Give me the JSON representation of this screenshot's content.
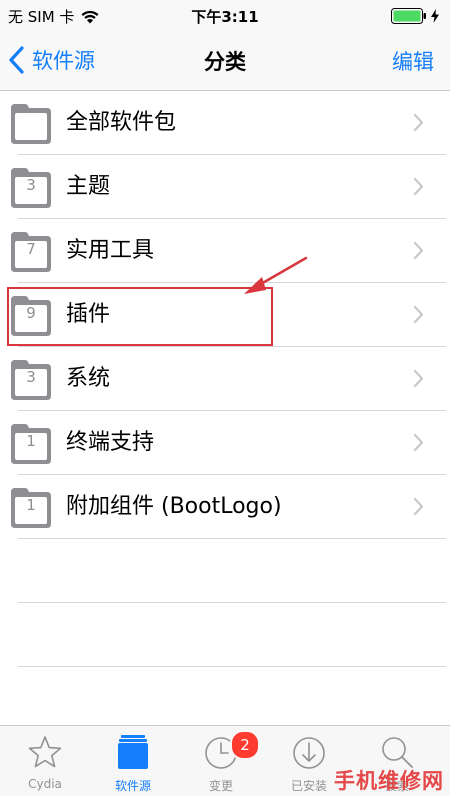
{
  "status_bar": {
    "carrier": "无 SIM 卡",
    "time": "下午3:11"
  },
  "nav": {
    "back_label": "软件源",
    "title": "分类",
    "edit_label": "编辑"
  },
  "categories": [
    {
      "label": "全部软件包",
      "count": ""
    },
    {
      "label": "主题",
      "count": "3"
    },
    {
      "label": "实用工具",
      "count": "7"
    },
    {
      "label": "插件",
      "count": "9"
    },
    {
      "label": "系统",
      "count": "3"
    },
    {
      "label": "终端支持",
      "count": "1"
    },
    {
      "label": "附加组件 (BootLogo)",
      "count": "1"
    }
  ],
  "annotation": {
    "highlighted_row": "插件",
    "color": "#d9363e"
  },
  "tab_bar": {
    "tabs": [
      {
        "label": "Cydia",
        "icon": "star-icon",
        "active": false
      },
      {
        "label": "软件源",
        "icon": "sources-icon",
        "active": true
      },
      {
        "label": "变更",
        "icon": "clock-icon",
        "active": false,
        "badge": "2"
      },
      {
        "label": "已安装",
        "icon": "download-icon",
        "active": false
      },
      {
        "label": "搜索",
        "icon": "search-icon",
        "active": false
      }
    ]
  },
  "watermark": "手机维修网",
  "colors": {
    "accent": "#157efb",
    "badge": "#ff3b30",
    "inactive": "#929292"
  }
}
